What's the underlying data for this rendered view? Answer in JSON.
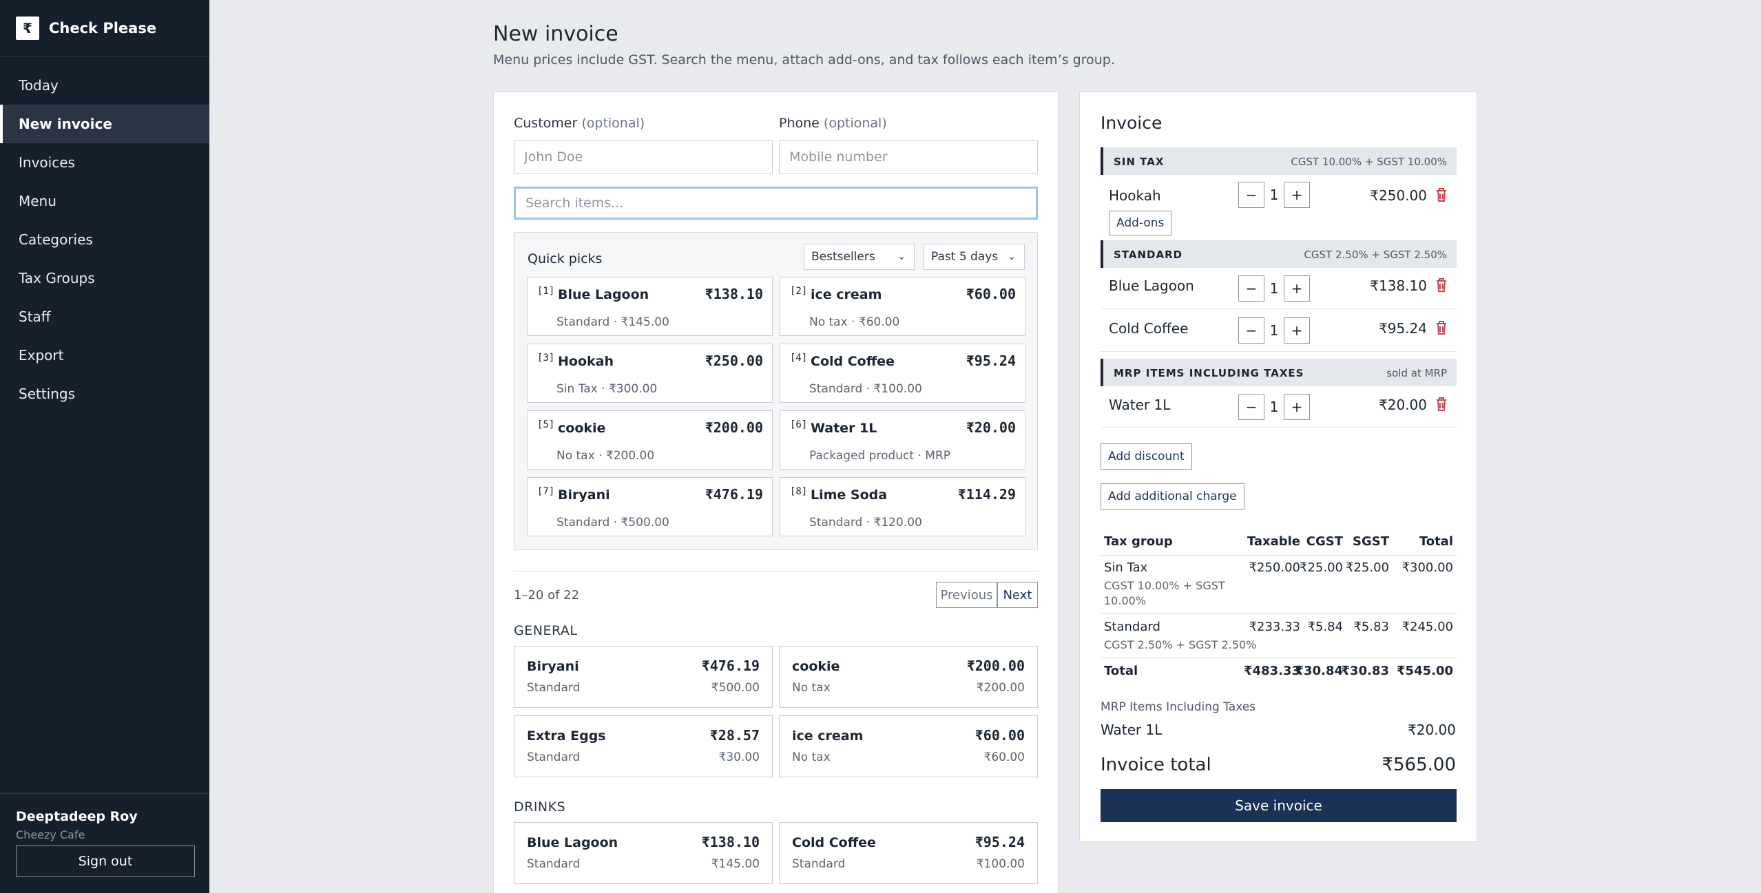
{
  "brand": {
    "logo": "₹",
    "name": "Check Please"
  },
  "nav": [
    "Today",
    "New invoice",
    "Invoices",
    "Menu",
    "Categories",
    "Tax Groups",
    "Staff",
    "Export",
    "Settings"
  ],
  "user": {
    "name": "Deeptadeep Roy",
    "org": "Cheezy Cafe",
    "signout": "Sign out"
  },
  "header": {
    "title": "New invoice",
    "subtitle": "Menu prices include GST. Search the menu, attach add-ons, and tax follows each item’s group."
  },
  "form": {
    "customer_label": "Customer",
    "customer_opt": "(optional)",
    "customer_placeholder": "John Doe",
    "phone_label": "Phone",
    "phone_opt": "(optional)",
    "phone_placeholder": "Mobile number",
    "search_placeholder": "Search items..."
  },
  "quick_picks": {
    "title": "Quick picks",
    "filter": "Bestsellers",
    "range": "Past 5 days",
    "items": [
      {
        "key": "[1]",
        "name": "Blue Lagoon",
        "price": "₹138.10",
        "meta": "Standard · ₹145.00"
      },
      {
        "key": "[2]",
        "name": "ice cream",
        "price": "₹60.00",
        "meta": "No tax · ₹60.00"
      },
      {
        "key": "[3]",
        "name": "Hookah",
        "price": "₹250.00",
        "meta": "Sin Tax · ₹300.00"
      },
      {
        "key": "[4]",
        "name": "Cold Coffee",
        "price": "₹95.24",
        "meta": "Standard · ₹100.00"
      },
      {
        "key": "[5]",
        "name": "cookie",
        "price": "₹200.00",
        "meta": "No tax · ₹200.00"
      },
      {
        "key": "[6]",
        "name": "Water 1L",
        "price": "₹20.00",
        "meta": "Packaged product · MRP"
      },
      {
        "key": "[7]",
        "name": "Biryani",
        "price": "₹476.19",
        "meta": "Standard · ₹500.00"
      },
      {
        "key": "[8]",
        "name": "Lime Soda",
        "price": "₹114.29",
        "meta": "Standard · ₹120.00"
      }
    ]
  },
  "pager": {
    "text": "1–20 of 22",
    "prev": "Previous",
    "next": "Next"
  },
  "menu": {
    "general_title": "GENERAL",
    "general": [
      {
        "name": "Biryani",
        "price": "₹476.19",
        "group": "Standard",
        "mrp": "₹500.00"
      },
      {
        "name": "cookie",
        "price": "₹200.00",
        "group": "No tax",
        "mrp": "₹200.00"
      },
      {
        "name": "Extra Eggs",
        "price": "₹28.57",
        "group": "Standard",
        "mrp": "₹30.00"
      },
      {
        "name": "ice cream",
        "price": "₹60.00",
        "group": "No tax",
        "mrp": "₹60.00"
      }
    ],
    "drinks_title": "DRINKS",
    "drinks": [
      {
        "name": "Blue Lagoon",
        "price": "₹138.10",
        "group": "Standard",
        "mrp": "₹145.00"
      },
      {
        "name": "Cold Coffee",
        "price": "₹95.24",
        "group": "Standard",
        "mrp": "₹100.00"
      }
    ]
  },
  "invoice": {
    "title": "Invoice",
    "groups": [
      {
        "name": "SIN TAX",
        "rate": "CGST 10.00% + SGST 10.00%"
      },
      {
        "name": "STANDARD",
        "rate": "CGST 2.50% + SGST 2.50%"
      },
      {
        "name": "MRP ITEMS INCLUDING TAXES",
        "rate": "sold at MRP"
      }
    ],
    "lines": [
      {
        "name": "Hookah",
        "qty": "1",
        "price": "₹250.00",
        "addons": "Add-ons"
      },
      {
        "name": "Blue Lagoon",
        "qty": "1",
        "price": "₹138.10"
      },
      {
        "name": "Cold Coffee",
        "qty": "1",
        "price": "₹95.24"
      },
      {
        "name": "Water 1L",
        "qty": "1",
        "price": "₹20.00"
      }
    ],
    "minus": "−",
    "plus": "+",
    "add_discount": "Add discount",
    "add_charge": "Add additional charge",
    "tax_table": {
      "headers": [
        "Tax group",
        "Taxable",
        "CGST",
        "SGST",
        "Total"
      ],
      "rows": [
        {
          "group": "Sin Tax",
          "sub1": "CGST 10.00% + SGST",
          "sub2": "10.00%",
          "taxable": "₹250.00",
          "cgst": "₹25.00",
          "sgst": "₹25.00",
          "total": "₹300.00"
        },
        {
          "group": "Standard",
          "sub1": "CGST 2.50% + SGST 2.50%",
          "sub2": "",
          "taxable": "₹233.33",
          "cgst": "₹5.84",
          "sgst": "₹5.83",
          "total": "₹245.00"
        }
      ],
      "total": {
        "label": "Total",
        "taxable": "₹483.33",
        "cgst": "₹30.84",
        "sgst": "₹30.83",
        "total": "₹545.00"
      }
    },
    "mrp_title": "MRP Items Including Taxes",
    "mrp_item": {
      "name": "Water 1L",
      "price": "₹20.00"
    },
    "total_label": "Invoice total",
    "total_value": "₹565.00",
    "save": "Save invoice"
  },
  "colors": {
    "sidebar": "#16202d",
    "primary": "#1a3355",
    "trash": "#c8454f"
  }
}
